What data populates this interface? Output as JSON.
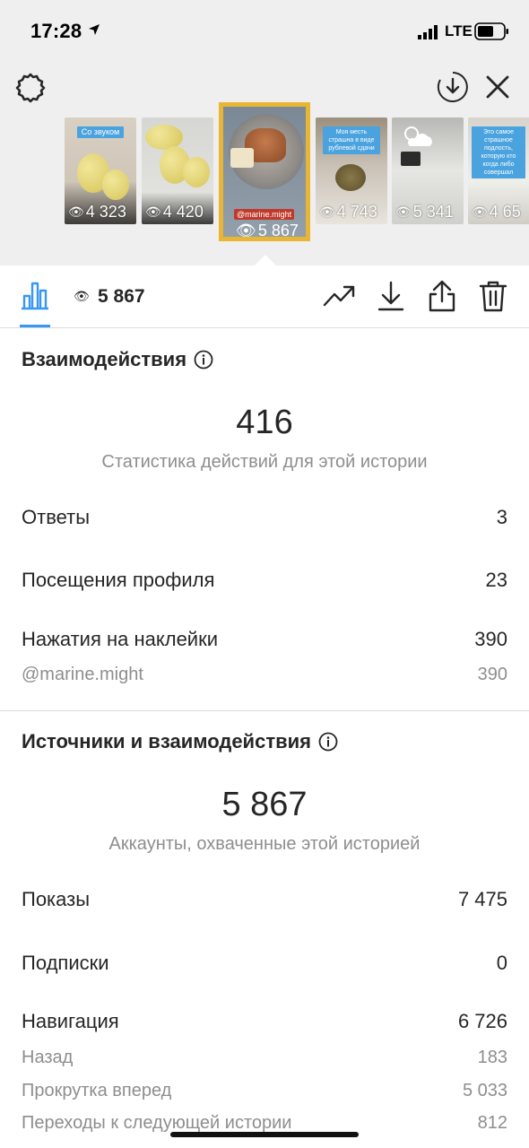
{
  "status_bar": {
    "time": "17:28",
    "network": "LTE"
  },
  "stories": [
    {
      "caption": "Со звуком",
      "views": "4 323"
    },
    {
      "caption": "",
      "views": "4 420"
    },
    {
      "caption": "",
      "mention": "@marine.might",
      "views": "5 867",
      "selected": true
    },
    {
      "caption": "Моя месть страшна в виде рублевой сдачи",
      "views": "4 743"
    },
    {
      "caption": "",
      "views": "5 341"
    },
    {
      "caption": "Это самое страшное подлость, которую кто когда либо совершал",
      "views": "4 65"
    }
  ],
  "toolbar": {
    "view_count": "5 867"
  },
  "interactions": {
    "title": "Взаимодействия",
    "total": "416",
    "total_caption": "Статистика действий для этой истории",
    "rows": [
      {
        "label": "Ответы",
        "value": "3"
      },
      {
        "label": "Посещения профиля",
        "value": "23"
      },
      {
        "label": "Нажатия на наклейки",
        "value": "390"
      }
    ],
    "sticker_rows": [
      {
        "label": "@marine.might",
        "value": "390"
      }
    ]
  },
  "discovery": {
    "title": "Источники и взаимодействия",
    "total": "5 867",
    "total_caption": "Аккаунты, охваченные этой историей",
    "rows": [
      {
        "label": "Показы",
        "value": "7 475"
      },
      {
        "label": "Подписки",
        "value": "0"
      },
      {
        "label": "Навигация",
        "value": "6 726"
      }
    ],
    "nav_rows": [
      {
        "label": "Назад",
        "value": "183"
      },
      {
        "label": "Прокрутка вперед",
        "value": "5 033"
      },
      {
        "label": "Переходы к следующей истории",
        "value": "812"
      }
    ]
  },
  "colors": {
    "accent": "#3897f0",
    "selected_border": "#e8b535",
    "secondary_text": "#8e8e8e"
  }
}
